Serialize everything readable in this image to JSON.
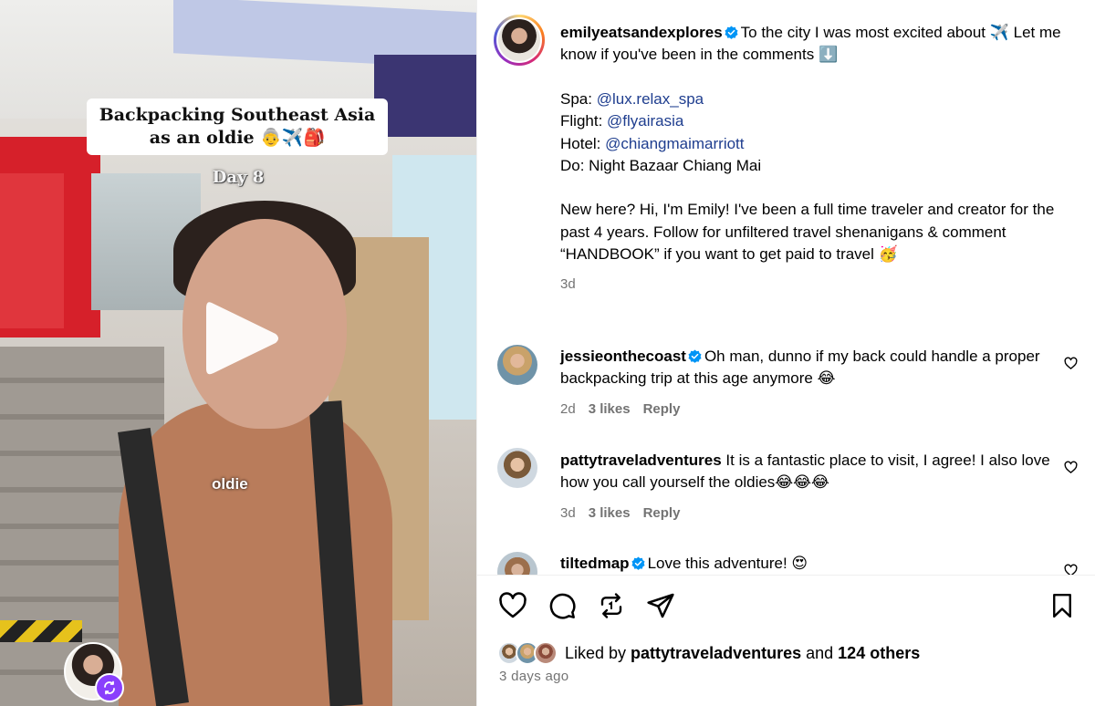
{
  "media": {
    "overlay_title_line1": "Backpacking Southeast Asia",
    "overlay_title_line2": "as an oldie 👵✈️🎒",
    "overlay_day": "Day 8",
    "overlay_word": "oldie",
    "play_icon": "play-icon",
    "remix_icon": "remix-icon"
  },
  "post": {
    "author": "emilyeatsandexplores",
    "caption_intro": "To the city I was most excited about ✈️ Let me know if you've been in the comments ⬇️",
    "spa_label": "Spa: ",
    "spa_link": "@lux.relax_spa",
    "flight_label": "Flight: ",
    "flight_link": "@flyairasia",
    "hotel_label": "Hotel: ",
    "hotel_link": "@chiangmaimarriott",
    "do_line": "Do: Night Bazaar Chiang Mai",
    "bio_paragraph": "New here? Hi, I'm Emily! I've been a full time traveler and creator for the past 4 years. Follow for unfiltered travel shenanigans & comment “HANDBOOK” if you want to get paid to travel 🥳",
    "time": "3d"
  },
  "comments": [
    {
      "user": "jessieonthecoast",
      "verified": true,
      "text": "Oh man, dunno if my back could handle a proper backpacking trip at this age anymore 😂",
      "time": "2d",
      "likes": "3 likes",
      "reply": "Reply"
    },
    {
      "user": "pattytraveladventures",
      "verified": false,
      "text": "It is a fantastic place to visit, I agree! I also love how you call yourself the oldies😂😂😂",
      "time": "3d",
      "likes": "3 likes",
      "reply": "Reply"
    },
    {
      "user": "tiltedmap",
      "verified": true,
      "text": "Love this adventure! 😍"
    }
  ],
  "footer": {
    "liked_by_prefix": "Liked by ",
    "liked_by_user": "pattytraveladventures",
    "liked_by_suffix": " and ",
    "liked_by_others": "124 others",
    "time_ago": "3 days ago"
  },
  "colors": {
    "link": "#1f3e8f",
    "verified": "#0095f6",
    "muted": "#737373",
    "remix_badge": "#8a3ffc"
  }
}
